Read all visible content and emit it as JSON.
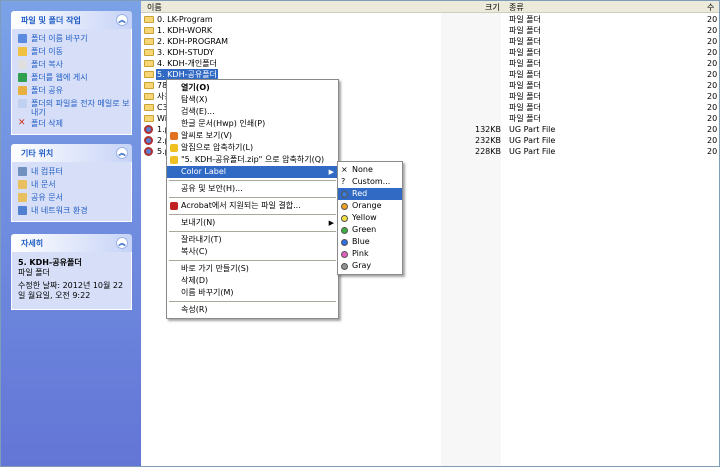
{
  "taskpane": {
    "file_tasks": {
      "title": "파일 및 폴더 작업",
      "items": [
        {
          "label": "폴더 이름 바꾸기",
          "icon": "rename-icon"
        },
        {
          "label": "폴더 이동",
          "icon": "move-icon"
        },
        {
          "label": "폴더 복사",
          "icon": "copy-icon"
        },
        {
          "label": "폴더를 웹에 게시",
          "icon": "web-publish-icon"
        },
        {
          "label": "폴더 공유",
          "icon": "share-icon"
        },
        {
          "label": "폴더의 파일을 전자 메일로 보내기",
          "icon": "email-icon"
        },
        {
          "label": "폴더 삭제",
          "icon": "delete-icon"
        }
      ]
    },
    "other_places": {
      "title": "기타 위치",
      "items": [
        {
          "label": "내 컴퓨터",
          "icon": "my-computer-icon"
        },
        {
          "label": "내 문서",
          "icon": "my-documents-icon"
        },
        {
          "label": "공유 문서",
          "icon": "shared-documents-icon"
        },
        {
          "label": "내 네트워크 환경",
          "icon": "network-icon"
        }
      ]
    },
    "details": {
      "title": "자세히",
      "name": "5. KDH-공유폴더",
      "type": "파일 폴더",
      "modified_line1": "수정한 날짜: 2012년 10월 22",
      "modified_line2": "일 월요일, 오전 9:22"
    }
  },
  "list": {
    "columns": {
      "name": "이름",
      "size": "크기",
      "type": "종류",
      "date": "수"
    },
    "rows": [
      {
        "icon": "folder",
        "name": "0. LK-Program",
        "size": "",
        "type": "파일 폴더",
        "date": "20"
      },
      {
        "icon": "folder",
        "name": "1. KDH-WORK",
        "size": "",
        "type": "파일 폴더",
        "date": "20"
      },
      {
        "icon": "folder",
        "name": "2. KDH-PROGRAM",
        "size": "",
        "type": "파일 폴더",
        "date": "20"
      },
      {
        "icon": "folder",
        "name": "3. KDH-STUDY",
        "size": "",
        "type": "파일 폴더",
        "date": "20"
      },
      {
        "icon": "folder",
        "name": "4. KDH-개인폴더",
        "size": "",
        "type": "파일 폴더",
        "date": "20"
      },
      {
        "icon": "folder",
        "name": "5. KDH-공유폴더",
        "size": "",
        "type": "파일 폴더",
        "date": "20",
        "selected": true
      },
      {
        "icon": "folder",
        "name": "78c",
        "size": "",
        "type": "파일 폴더",
        "date": "20"
      },
      {
        "icon": "folder",
        "name": "사용",
        "size": "",
        "type": "파일 폴더",
        "date": "20"
      },
      {
        "icon": "folder",
        "name": "C3",
        "size": "",
        "type": "파일 폴더",
        "date": "20"
      },
      {
        "icon": "folder",
        "name": "Win",
        "size": "",
        "type": "파일 폴더",
        "date": "20"
      },
      {
        "icon": "part",
        "name": "1.p",
        "size": "132KB",
        "type": "UG Part File",
        "date": "20"
      },
      {
        "icon": "part",
        "name": "2.p",
        "size": "232KB",
        "type": "UG Part File",
        "date": "20"
      },
      {
        "icon": "part",
        "name": "5.p",
        "size": "228KB",
        "type": "UG Part File",
        "date": "20"
      }
    ]
  },
  "context_menu": {
    "items": [
      {
        "type": "item",
        "label": "열기(O)",
        "bold": true
      },
      {
        "type": "item",
        "label": "탐색(X)"
      },
      {
        "type": "item",
        "label": "검색(E)..."
      },
      {
        "type": "item",
        "label": "한글 문서(Hwp) 인쇄(P)"
      },
      {
        "type": "item",
        "label": "알씨로 보기(V)",
        "icon": "alsee-icon"
      },
      {
        "type": "item",
        "label": "알집으로 압축하기(L)",
        "icon": "alzip-icon"
      },
      {
        "type": "item",
        "label": "\"5. KDH-공유폴더.zip\" 으로 압축하기(Q)",
        "icon": "alzip-icon"
      },
      {
        "type": "item",
        "label": "Color Label",
        "submenu": true,
        "highlighted": true
      },
      {
        "type": "sep"
      },
      {
        "type": "item",
        "label": "공유 및 보안(H)..."
      },
      {
        "type": "sep"
      },
      {
        "type": "item",
        "label": "Acrobat에서 지원되는 파일 결합...",
        "icon": "acrobat-icon"
      },
      {
        "type": "sep"
      },
      {
        "type": "item",
        "label": "보내기(N)",
        "submenu": true
      },
      {
        "type": "sep"
      },
      {
        "type": "item",
        "label": "잘라내기(T)"
      },
      {
        "type": "item",
        "label": "복사(C)"
      },
      {
        "type": "sep"
      },
      {
        "type": "item",
        "label": "바로 가기 만들기(S)"
      },
      {
        "type": "item",
        "label": "삭제(D)"
      },
      {
        "type": "item",
        "label": "이름 바꾸기(M)"
      },
      {
        "type": "sep"
      },
      {
        "type": "item",
        "label": "속성(R)"
      }
    ]
  },
  "color_submenu": {
    "items": [
      {
        "label": "None",
        "mark": "×"
      },
      {
        "label": "Custom...",
        "mark": "?"
      },
      {
        "label": "Red",
        "color": "#3a7bd5",
        "highlighted": true
      },
      {
        "label": "Orange",
        "color": "#f0a020"
      },
      {
        "label": "Yellow",
        "color": "#f0e040"
      },
      {
        "label": "Green",
        "color": "#40b040"
      },
      {
        "label": "Blue",
        "color": "#3070e0"
      },
      {
        "label": "Pink",
        "color": "#e060c0"
      },
      {
        "label": "Gray",
        "color": "#909090"
      }
    ]
  }
}
